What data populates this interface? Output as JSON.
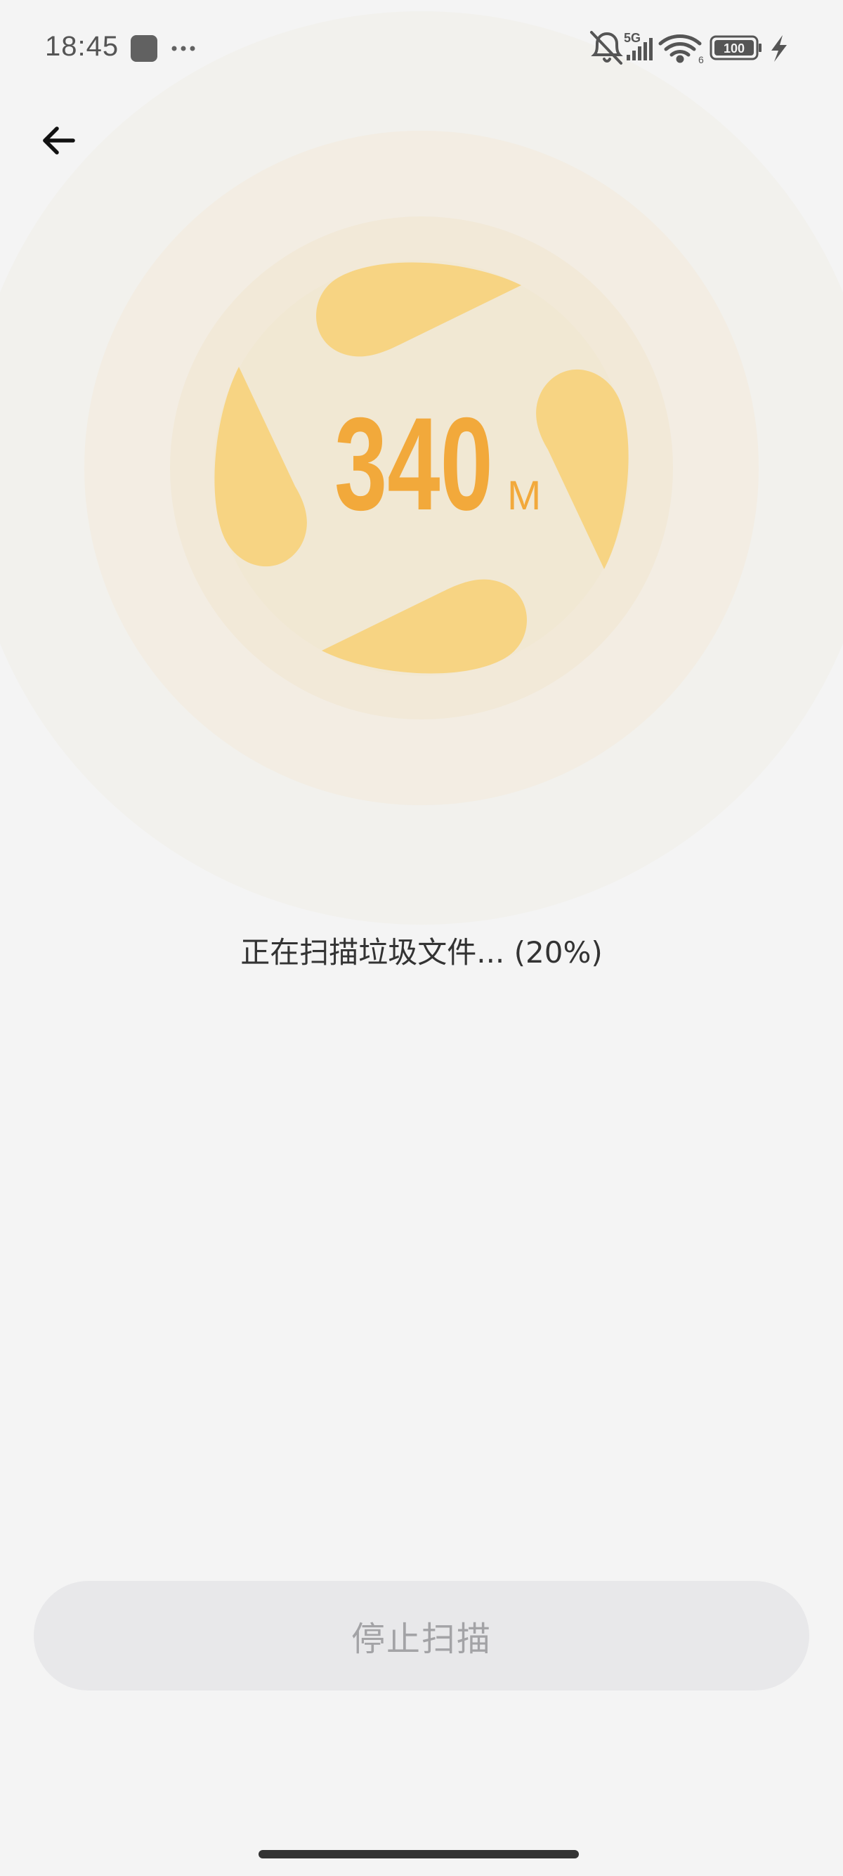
{
  "status_bar": {
    "time": "18:45",
    "network_label": "5G",
    "wifi_label": "6",
    "battery_level": "100",
    "icons": [
      "app-notification-icon",
      "more-dots-icon",
      "mute-bell-icon",
      "cellular-signal-icon",
      "wifi-icon",
      "battery-icon",
      "charging-bolt-icon"
    ]
  },
  "header": {
    "back_icon": "arrow-left-icon"
  },
  "scan": {
    "value": "340",
    "unit": "M",
    "status_text": "正在扫描垃圾文件... (20%)",
    "progress_percent": 20
  },
  "actions": {
    "stop_label": "停止扫描"
  },
  "colors": {
    "accent": "#f2a93b",
    "blade": "#f7d483",
    "background": "#f4f4f4",
    "button_bg": "#e8e8ea",
    "button_text": "#a3a3a6"
  }
}
